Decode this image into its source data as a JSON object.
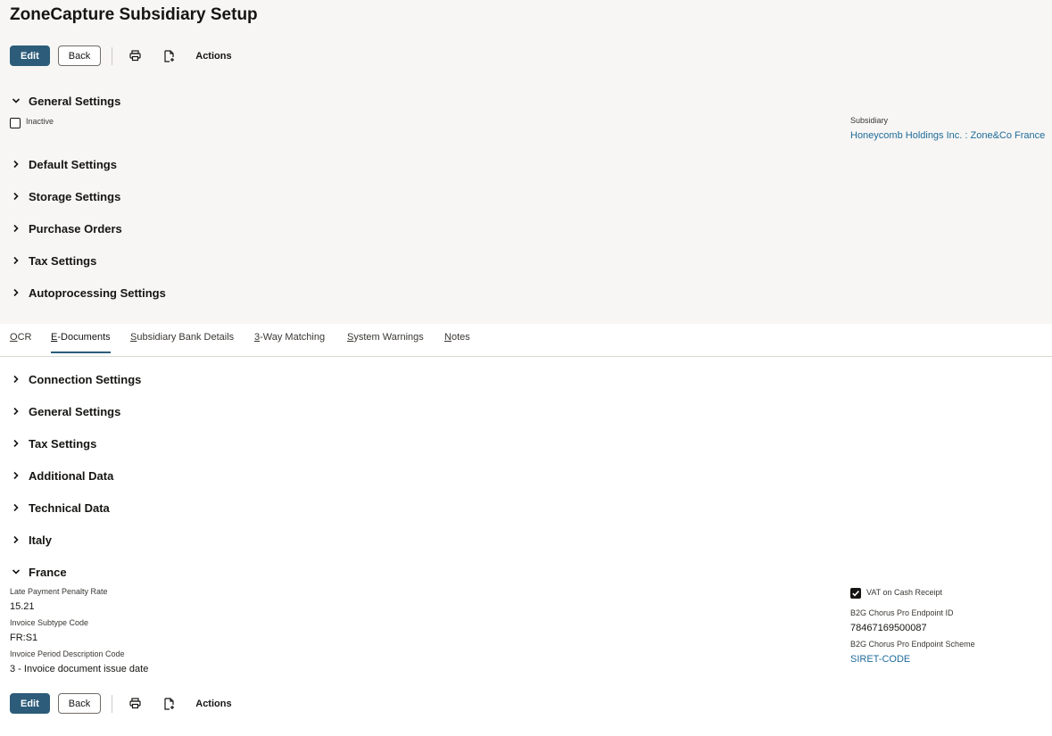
{
  "page": {
    "title": "ZoneCapture Subsidiary Setup"
  },
  "toolbar": {
    "edit_label": "Edit",
    "back_label": "Back",
    "print_icon": "print-icon",
    "export_icon": "export-document-icon",
    "actions_label": "Actions"
  },
  "main_sections": {
    "general": {
      "title": "General Settings",
      "expanded": true,
      "inactive_label": "Inactive",
      "inactive_checked": false,
      "subsidiary_label": "Subsidiary",
      "subsidiary_value": "Honeycomb Holdings Inc. : Zone&Co France"
    },
    "collapsed": [
      {
        "title": "Default Settings"
      },
      {
        "title": "Storage Settings"
      },
      {
        "title": "Purchase Orders"
      },
      {
        "title": "Tax Settings"
      },
      {
        "title": "Autoprocessing Settings"
      }
    ]
  },
  "tabs": [
    {
      "mnemonic": "O",
      "rest": "CR",
      "active": false
    },
    {
      "mnemonic": "E",
      "rest": "-Documents",
      "active": true
    },
    {
      "mnemonic": "S",
      "rest": "ubsidiary Bank Details",
      "active": false
    },
    {
      "mnemonic": "3",
      "rest": "-Way Matching",
      "active": false
    },
    {
      "mnemonic": "S",
      "rest": "ystem Warnings",
      "active": false
    },
    {
      "mnemonic": "N",
      "rest": "otes",
      "active": false
    }
  ],
  "edoc_sections": {
    "collapsed": [
      {
        "title": "Connection Settings"
      },
      {
        "title": "General Settings"
      },
      {
        "title": "Tax Settings"
      },
      {
        "title": "Additional Data"
      },
      {
        "title": "Technical Data"
      },
      {
        "title": "Italy"
      }
    ],
    "france": {
      "title": "France",
      "expanded": true,
      "late_payment_label": "Late Payment Penalty Rate",
      "late_payment_value": "15.21",
      "invoice_subtype_label": "Invoice Subtype Code",
      "invoice_subtype_value": "FR:S1",
      "invoice_period_label": "Invoice Period Description Code",
      "invoice_period_value": "3 - Invoice document issue date",
      "vat_cash_label": "VAT on Cash Receipt",
      "vat_cash_checked": true,
      "b2g_id_label": "B2G Chorus Pro Endpoint ID",
      "b2g_id_value": "78467169500087",
      "b2g_scheme_label": "B2G Chorus Pro Endpoint Scheme",
      "b2g_scheme_value": "SIRET-CODE"
    }
  },
  "colors": {
    "primary_button": "#2c5c79",
    "link": "#1f6b9a",
    "top_background": "#f7f6f4"
  }
}
